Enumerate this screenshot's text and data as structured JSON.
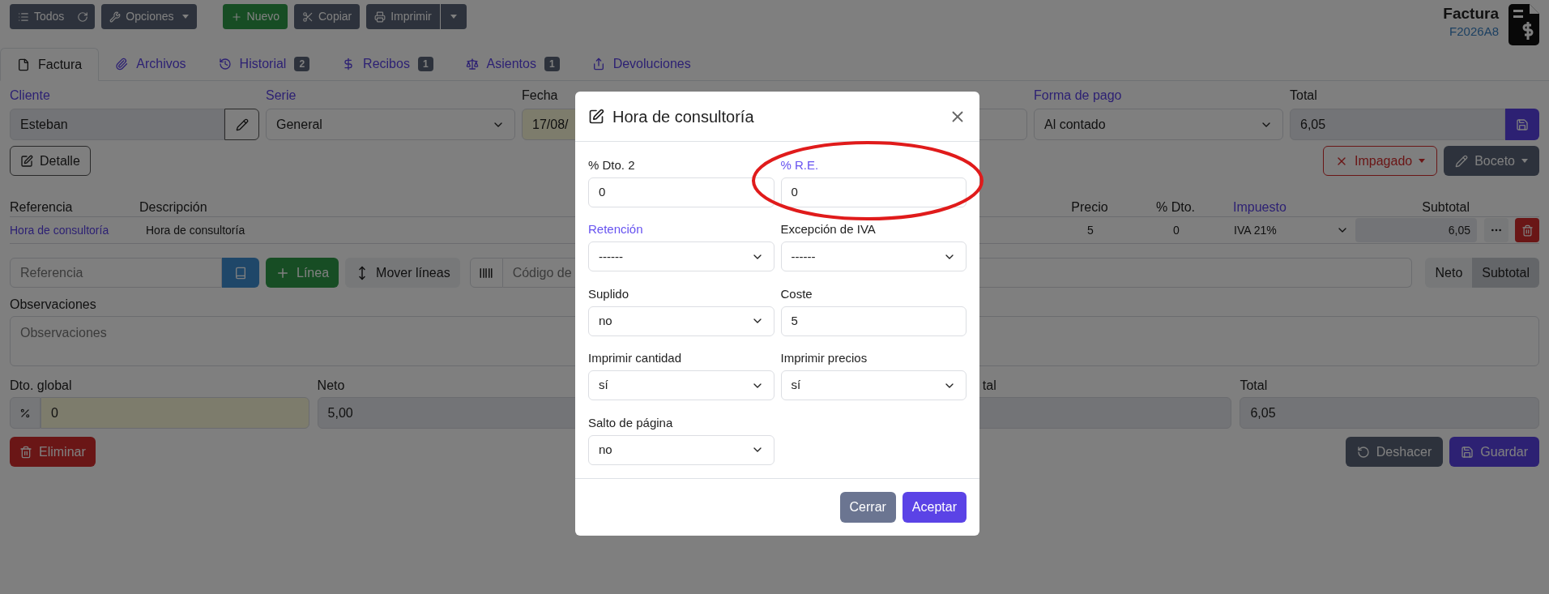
{
  "toolbar": {
    "navigation": [
      {
        "label": "Todos",
        "kind": "refresh"
      },
      {
        "label": "Opciones",
        "kind": "dropdown"
      }
    ],
    "actions": [
      {
        "label": "Nuevo",
        "kind": "success"
      },
      {
        "label": "Copiar",
        "kind": "dark"
      },
      {
        "label": "Imprimir",
        "kind": "split"
      }
    ]
  },
  "header": {
    "title": "Factura",
    "code": "F2026A8"
  },
  "tabs": [
    {
      "label": "Factura",
      "selected": true
    },
    {
      "label": "Archivos",
      "selected": false
    },
    {
      "label": "Historial",
      "badge": "2",
      "selected": false
    },
    {
      "label": "Recibos",
      "badge": "1",
      "selected": false
    },
    {
      "label": "Asientos",
      "badge": "1",
      "selected": false
    },
    {
      "label": "Devoluciones",
      "selected": false
    }
  ],
  "fields": [
    {
      "label": "Cliente",
      "value": "Esteban",
      "link": true,
      "kind": "client"
    },
    {
      "label": "Serie",
      "value": "General",
      "link": true,
      "kind": "select"
    },
    {
      "label": "Fecha",
      "value": "17/08/",
      "link": false,
      "kind": "date"
    },
    {
      "kind": "covered"
    },
    {
      "label": "Forma de pago",
      "value": "Al contado",
      "link": true,
      "kind": "select"
    },
    {
      "label": "Total",
      "value": "6,05",
      "link": false,
      "kind": "total"
    }
  ],
  "detail_button": "Detalle",
  "status_buttons": [
    {
      "label": "Impagado",
      "kind": "danger-outline"
    },
    {
      "label": "Boceto",
      "kind": "dark"
    }
  ],
  "lines": {
    "columns": [
      {
        "label": "Referencia",
        "link": false
      },
      {
        "label": "Descripción",
        "link": false
      },
      {
        "label": "Precio",
        "link": false
      },
      {
        "label": "% Dto.",
        "link": false
      },
      {
        "label": "Impuesto",
        "link": true
      },
      {
        "label": "Subtotal",
        "link": false
      }
    ],
    "rows": [
      {
        "reference": "Hora de consultoría",
        "description": "Hora de consultoría",
        "price": "5",
        "discount": "0",
        "tax": "IVA 21%",
        "subtotal": "6,05"
      }
    ]
  },
  "add_line": {
    "reference_placeholder": "Referencia",
    "add_button": "Línea",
    "move_button": "Mover líneas",
    "barcode_placeholder": "Código de",
    "toggle": [
      {
        "label": "Neto",
        "selected": false
      },
      {
        "label": "Subtotal",
        "selected": true
      }
    ]
  },
  "notes": {
    "label": "Observaciones",
    "placeholder": "Observaciones"
  },
  "totals": [
    {
      "label": "Dto. global",
      "value": "0",
      "kind": "discount"
    },
    {
      "label": "Neto",
      "value": "5,00",
      "kind": "readonly"
    },
    {
      "kind": "covered"
    },
    {
      "label": "tal",
      "kind": "partial"
    },
    {
      "label": "Total",
      "value": "6,05",
      "kind": "readonly"
    }
  ],
  "footer_buttons": [
    {
      "label": "Eliminar",
      "kind": "danger"
    },
    {
      "label": "Deshacer",
      "kind": "dark"
    },
    {
      "label": "Guardar",
      "kind": "primary"
    }
  ],
  "modal": {
    "title": "Hora de consultoría",
    "fields": [
      {
        "label": "% Dto. 2",
        "value": "0",
        "kind": "input",
        "link": false
      },
      {
        "label": "% R.E.",
        "value": "0",
        "kind": "input",
        "link": true
      },
      {
        "label": "Retención",
        "value": "------",
        "kind": "select",
        "link": true
      },
      {
        "label": "Excepción de IVA",
        "value": "------",
        "kind": "select",
        "link": false
      },
      {
        "label": "Suplido",
        "value": "no",
        "kind": "select",
        "link": false
      },
      {
        "label": "Coste",
        "value": "5",
        "kind": "input",
        "link": false
      },
      {
        "label": "Imprimir cantidad",
        "value": "sí",
        "kind": "select",
        "link": false
      },
      {
        "label": "Imprimir precios",
        "value": "sí",
        "kind": "select",
        "link": false
      },
      {
        "label": "Salto de página",
        "value": "no",
        "kind": "select",
        "link": false
      }
    ],
    "buttons": [
      {
        "label": "Cerrar",
        "kind": "secondary"
      },
      {
        "label": "Aceptar",
        "kind": "primary"
      }
    ]
  },
  "annotation": {
    "kind": "ellipse"
  }
}
